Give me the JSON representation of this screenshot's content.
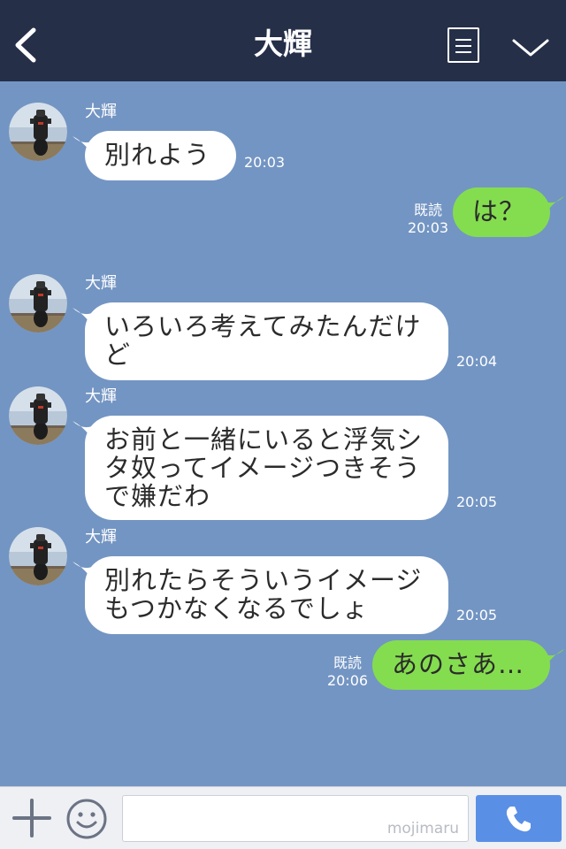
{
  "header": {
    "title": "大輝",
    "back_icon": "chevron-left-icon",
    "menu_icon": "list-icon",
    "expand_icon": "chevron-down-icon",
    "bg_color": "#252f48"
  },
  "chat": {
    "bg_color": "#7395c3",
    "messages": [
      {
        "direction": "in",
        "sender": "大輝",
        "text": "別れよう",
        "time": "20:03"
      },
      {
        "direction": "out",
        "read": "既読",
        "text": "は？",
        "time": "20:03"
      },
      {
        "direction": "in",
        "sender": "大輝",
        "text": "いろいろ考えてみたんだけど",
        "time": "20:04"
      },
      {
        "direction": "in",
        "sender": "大輝",
        "text": "お前と一緒にいると浮気シタ奴ってイメージつきそうで嫌だわ",
        "time": "20:05"
      },
      {
        "direction": "in",
        "sender": "大輝",
        "text": "別れたらそういうイメージもつかなくなるでしょ",
        "time": "20:05"
      },
      {
        "direction": "out",
        "read": "既読",
        "text": "あのさあ…",
        "time": "20:06"
      }
    ],
    "incoming_bubble_color": "#ffffff",
    "outgoing_bubble_color": "#84dd4f"
  },
  "input_bar": {
    "plus_icon": "plus-icon",
    "emoji_icon": "smiley-icon",
    "watermark": "mojimaru",
    "call_icon": "phone-icon",
    "call_color": "#5a8fe6"
  }
}
